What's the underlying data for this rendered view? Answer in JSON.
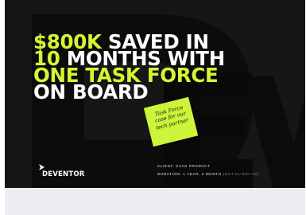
{
  "case_card": {
    "background_letters": "DEV",
    "headline": {
      "line1_lime": "$800K",
      "line1_white": "SAVED IN",
      "line2_lime": "10",
      "line2_white": "MONTHS  WITH",
      "line3_lime": "ONE TASK FORCE",
      "line4_white": "ON BOARD"
    },
    "sticky_note": {
      "line1": "Task Force",
      "line2": "case for our",
      "line3": "tech partner"
    },
    "logo": {
      "text": "DEVENTOR"
    },
    "meta": {
      "client": "CLIENT: SAAS PRODUCT",
      "duration": "DURATION: 1 YEAR, 2 MONTH",
      "duration_range": "(OCT'21-NOV'22)"
    }
  },
  "colors": {
    "card_bg": "#161616",
    "accent_lime": "#d8f431",
    "sticky_note": "#ccf43a",
    "page_below": "#edeef2"
  }
}
